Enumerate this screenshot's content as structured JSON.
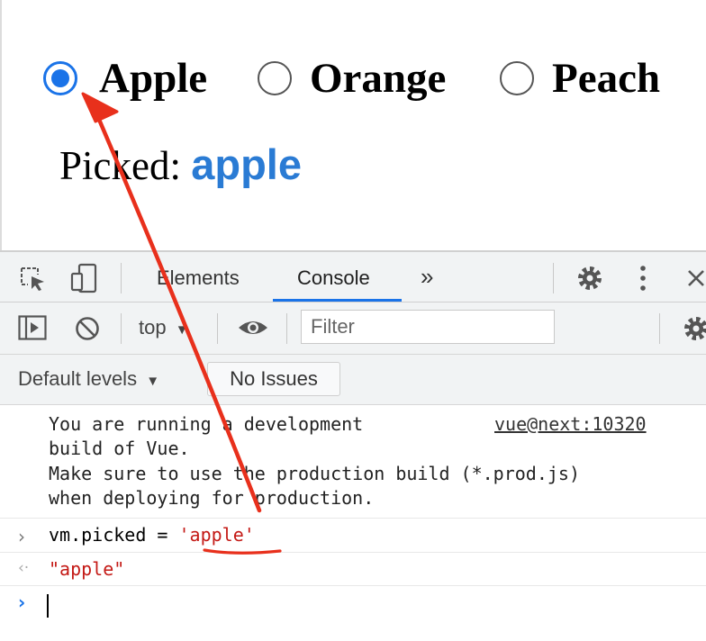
{
  "app": {
    "radio_options": [
      {
        "label": "Apple",
        "checked": true
      },
      {
        "label": "Orange",
        "checked": false
      },
      {
        "label": "Peach",
        "checked": false
      }
    ],
    "picked_label": "Picked:",
    "picked_value": "apple"
  },
  "devtools": {
    "tabs": [
      {
        "label": "Elements",
        "active": false
      },
      {
        "label": "Console",
        "active": true
      }
    ],
    "more_tabs_glyph": "»",
    "context": "top",
    "filter_placeholder": "Filter",
    "levels": "Default levels",
    "issues": "No Issues",
    "accent_color": "#1a73e8",
    "icons": [
      "inspect-element-icon",
      "device-toolbar-icon",
      "gear-icon",
      "kebab-menu-icon",
      "close-icon",
      "sidebar-toggle-icon",
      "clear-console-icon",
      "eye-icon"
    ]
  },
  "console": {
    "message_lines": [
      "You are running a development",
      "build of Vue.",
      "Make sure to use the production build (*.prod.js)",
      "when deploying for production."
    ],
    "source_link": "vue@next:10320",
    "command_prefix": "vm.picked = ",
    "command_string": "'apple'",
    "result": "\"apple\""
  },
  "annotation": {
    "color": "#e8301c"
  }
}
